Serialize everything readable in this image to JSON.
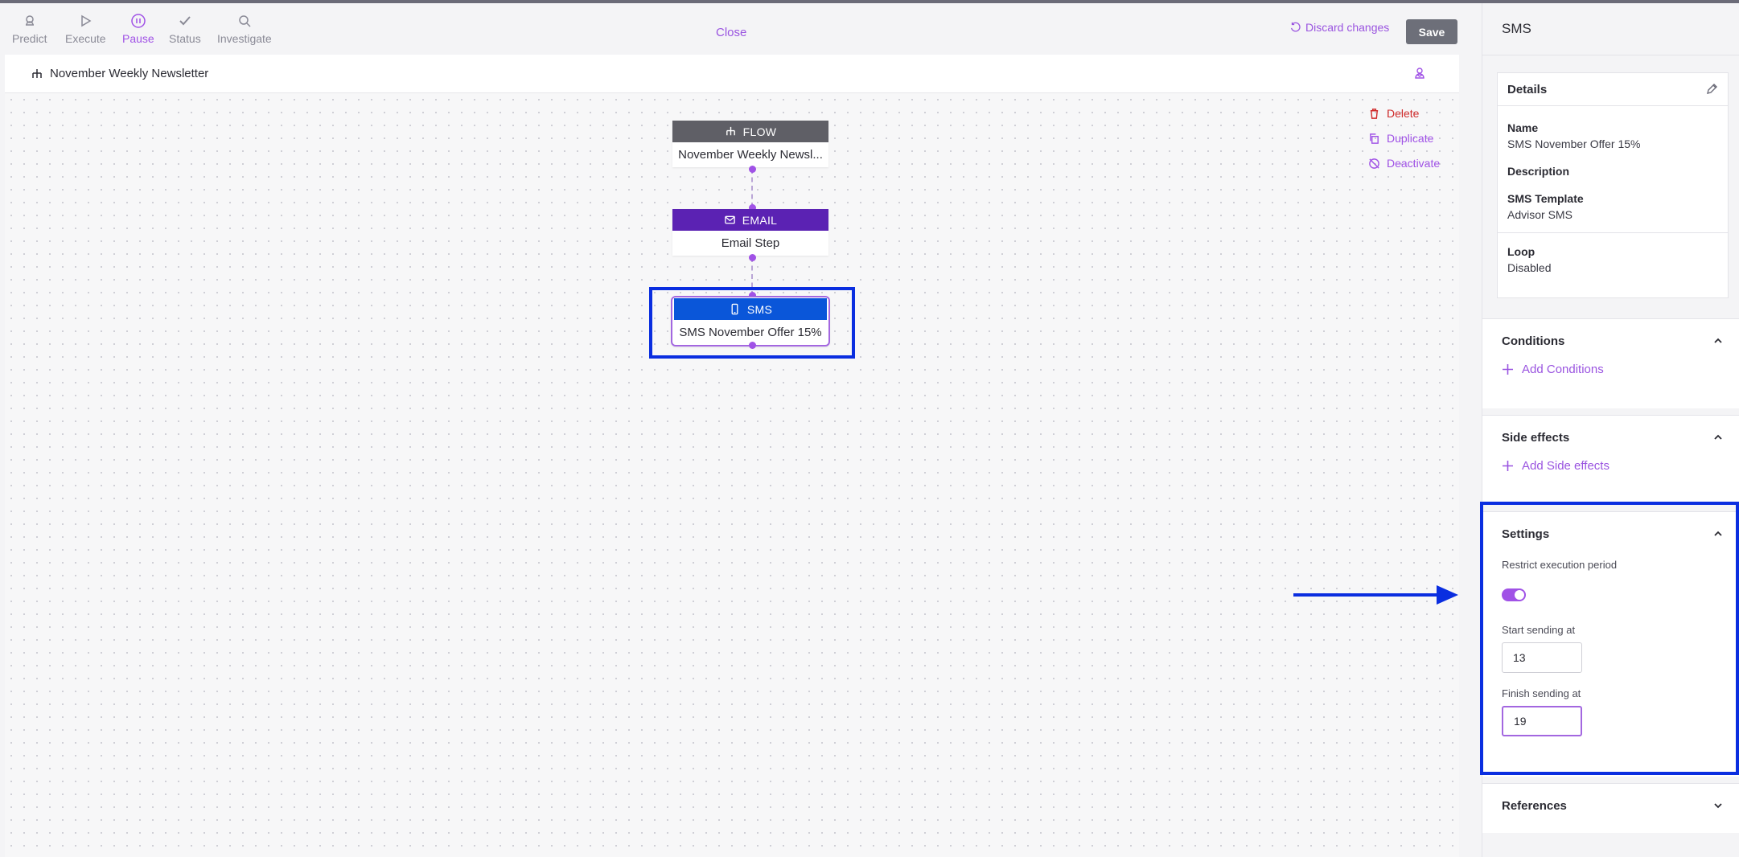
{
  "toolbar": {
    "tools": [
      {
        "label": "Predict",
        "icon": "predict-icon"
      },
      {
        "label": "Execute",
        "icon": "play-icon"
      },
      {
        "label": "Pause",
        "icon": "pause-icon",
        "active": true
      },
      {
        "label": "Status",
        "icon": "check-icon"
      },
      {
        "label": "Investigate",
        "icon": "search-icon"
      }
    ],
    "close_label": "Close",
    "discard_label": "Discard changes",
    "save_label": "Save"
  },
  "canvas": {
    "flow_title": "November Weekly Newsletter",
    "actions": {
      "delete": "Delete",
      "duplicate": "Duplicate",
      "deactivate": "Deactivate"
    },
    "nodes": [
      {
        "type": "FLOW",
        "label": "November Weekly Newsl...",
        "color": "#5f5f66"
      },
      {
        "type": "EMAIL",
        "label": "Email Step",
        "color": "#5b22b3"
      },
      {
        "type": "SMS",
        "label": "SMS November Offer 15%",
        "color": "#0a56d9",
        "selected": true
      }
    ]
  },
  "panel": {
    "title": "SMS",
    "details": {
      "heading": "Details",
      "name_label": "Name",
      "name_value": "SMS November Offer 15%",
      "description_label": "Description",
      "template_label": "SMS Template",
      "template_value": "Advisor SMS",
      "loop_label": "Loop",
      "loop_value": "Disabled"
    },
    "conditions": {
      "heading": "Conditions",
      "add_label": "Add Conditions"
    },
    "side_effects": {
      "heading": "Side effects",
      "add_label": "Add Side effects"
    },
    "settings": {
      "heading": "Settings",
      "restrict_label": "Restrict execution period",
      "restrict_enabled": true,
      "start_label": "Start sending at",
      "start_value": "13",
      "finish_label": "Finish sending at",
      "finish_value": "19"
    },
    "references": {
      "heading": "References"
    }
  },
  "colors": {
    "accent": "#a052e6",
    "highlight": "#0a2ee0",
    "danger": "#cf2b2b"
  }
}
